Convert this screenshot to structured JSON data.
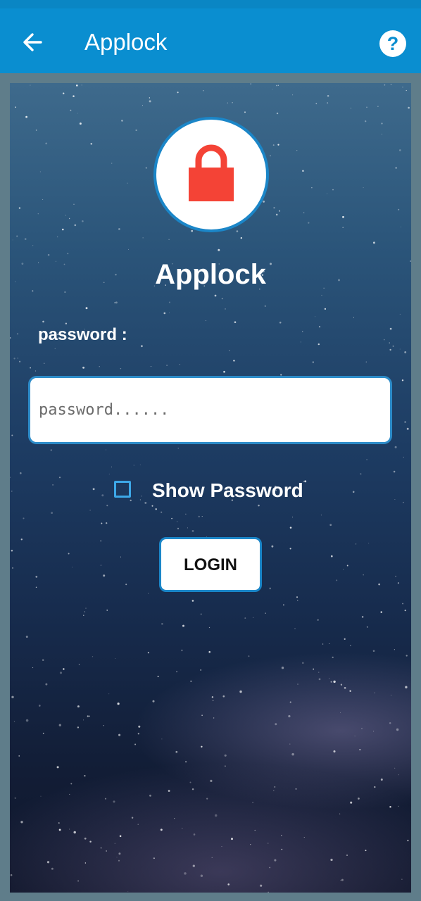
{
  "appbar": {
    "title": "Applock",
    "back_icon": "arrow-left-icon",
    "help_icon": "help-question-icon"
  },
  "main": {
    "logo_icon": "padlock-icon",
    "heading": "Applock",
    "password_label": "password :",
    "password_placeholder": "password......",
    "show_password_label": "Show Password",
    "show_password_checked": false,
    "login_button": "LOGIN"
  },
  "colors": {
    "app_bar": "#0a8ed0",
    "status_bar": "#0a86c4",
    "lock_red": "#f44336",
    "accent_blue": "#1b86c8",
    "frame": "#5f7d8a"
  }
}
